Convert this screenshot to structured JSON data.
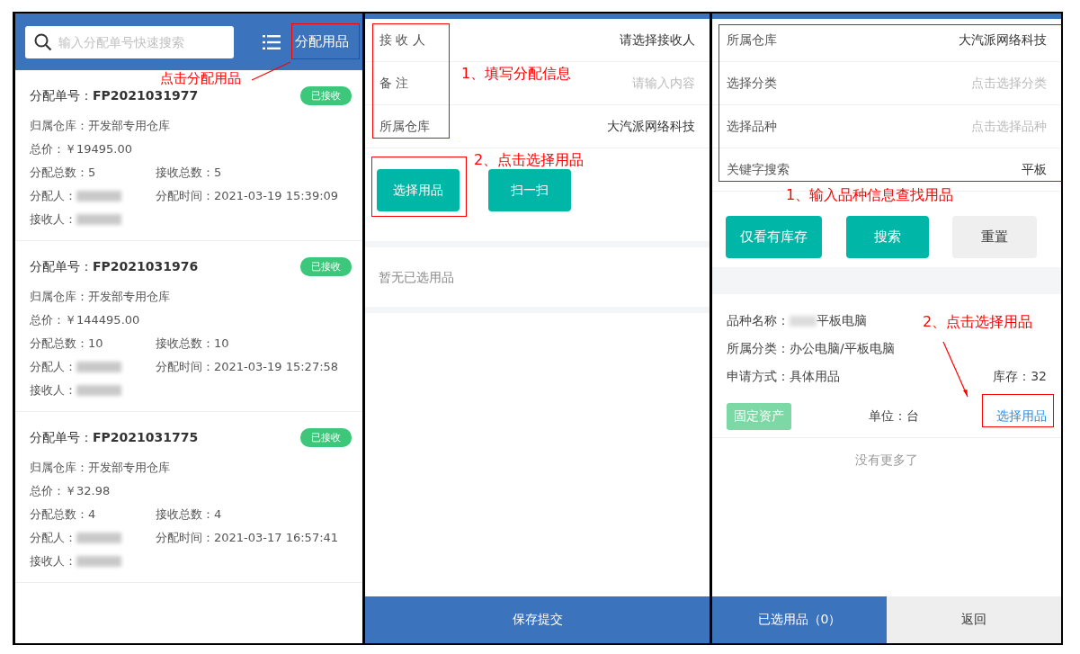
{
  "list_screen": {
    "search": {
      "placeholder": "输入分配单号快速搜索"
    },
    "action_button": "分配用品",
    "orders": [
      {
        "number_label": "分配单号：",
        "number": "FP2021031977",
        "status": "已接收",
        "warehouse": "归属仓库：开发部专用仓库",
        "price": "总价：￥19495.00",
        "assigned_count": "分配总数：5",
        "received_count": "接收总数：5",
        "assigner_label": "分配人：",
        "time": "分配时间：2021-03-19 15:39:09",
        "receiver_label": "接收人："
      },
      {
        "number_label": "分配单号：",
        "number": "FP2021031976",
        "status": "已接收",
        "warehouse": "归属仓库：开发部专用仓库",
        "price": "总价：￥144495.00",
        "assigned_count": "分配总数：10",
        "received_count": "接收总数：10",
        "assigner_label": "分配人：",
        "time": "分配时间：2021-03-19 15:27:58",
        "receiver_label": "接收人："
      },
      {
        "number_label": "分配单号：",
        "number": "FP2021031775",
        "status": "已接收",
        "warehouse": "归属仓库：开发部专用仓库",
        "price": "总价：￥32.98",
        "assigned_count": "分配总数：4",
        "received_count": "接收总数：4",
        "assigner_label": "分配人：",
        "time": "分配时间：2021-03-17 16:57:41",
        "receiver_label": "接收人："
      }
    ],
    "annotation": "点击分配用品"
  },
  "form_screen": {
    "fields": [
      {
        "label": "接 收 人",
        "value": "请选择接收人",
        "kind": "value"
      },
      {
        "label": "备 注",
        "placeholder": "请输入内容",
        "kind": "placeholder"
      },
      {
        "label": "所属仓库",
        "value": "大汽派网络科技",
        "kind": "value"
      }
    ],
    "buttons": [
      "选择用品",
      "扫一扫"
    ],
    "empty_text": "暂无已选用品",
    "submit_button": "保存提交",
    "annotations": [
      "1、填写分配信息",
      "2、点击选择用品"
    ]
  },
  "picker_screen": {
    "fields": [
      {
        "label": "所属仓库",
        "value": "大汽派网络科技",
        "kind": "value"
      },
      {
        "label": "选择分类",
        "placeholder": "点击选择分类",
        "kind": "placeholder"
      },
      {
        "label": "选择品种",
        "placeholder": "点击选择品种",
        "kind": "placeholder"
      },
      {
        "label": "关键字搜索",
        "value": "平板",
        "kind": "value"
      }
    ],
    "buttons": [
      {
        "label": "仅看有库存",
        "kind": "primary"
      },
      {
        "label": "搜索",
        "kind": "primary"
      },
      {
        "label": "重置",
        "kind": "secondary"
      }
    ],
    "result": {
      "name_label": "品种名称：",
      "name": "平板电脑",
      "category": "所属分类：办公电脑/平板电脑",
      "method": "申请方式：具体用品",
      "stock": "库存：32",
      "tag": "固定资产",
      "unit": "单位：台",
      "select_link": "选择用品"
    },
    "end_text": "没有更多了",
    "tabs": [
      {
        "label": "已选用品（0）",
        "selected": true
      },
      {
        "label": "返回",
        "selected": false
      }
    ],
    "annotations": [
      "1、输入品种信息查找用品",
      "2、点击选择用品"
    ]
  }
}
